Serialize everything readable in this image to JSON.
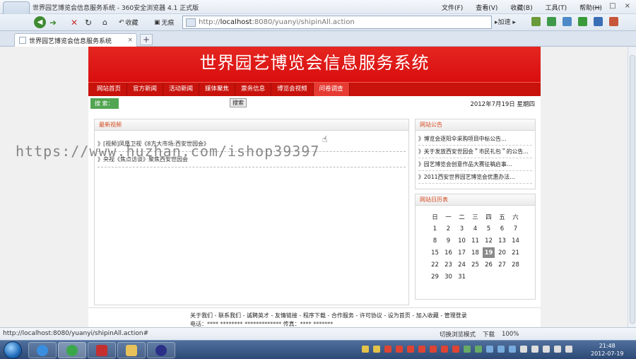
{
  "window": {
    "title": "世界园艺博览会信息服务系统 - 360安全浏览器 4.1 正式版",
    "menus": [
      "文件(F)",
      "查看(V)",
      "收藏(B)",
      "工具(T)",
      "帮助(H)"
    ],
    "controls": [
      "一",
      "□",
      "×"
    ]
  },
  "toolbar": {
    "favorites_label": "收藏",
    "tools_label": "无痕",
    "address_prefix": "http://",
    "address_host": "localhost",
    "address_rest": ":8080/yuanyi/shipinAll.action",
    "go_label": "加速"
  },
  "tab": {
    "title": "世界园艺博览会信息服务系统",
    "close": "×",
    "add": "+"
  },
  "site": {
    "banner_title": "世界园艺博览会信息服务系统",
    "nav": [
      "网站首页",
      "官方新闻",
      "活动新闻",
      "媒体聚焦",
      "票务信息",
      "博览会视频",
      "问卷调查"
    ],
    "search_tag": "搜 索：",
    "search_button": "搜索",
    "date": "2012年7月19日 星期四",
    "news_header": "最新视频",
    "news_items": [
      "》[视频]凤凰卫视《8方大市场:西安世园会》",
      "》央视《焦点访谈》聚焦西安世园会"
    ],
    "notice_header": "网站公告",
    "notices": [
      "》博览会逐阳伞采购项目中标公告…",
      "》关于发放西安世园会＂市民礼包＂的公告…",
      "》园艺博览会创意作品大赛征稿启事…",
      "》2011西安世界园艺博览会优惠办法…"
    ],
    "calendar_header": "网站日历表",
    "calendar_weekdays": [
      "日",
      "一",
      "二",
      "三",
      "四",
      "五",
      "六"
    ],
    "calendar_weeks": [
      [
        "1",
        "2",
        "3",
        "4",
        "5",
        "6",
        "7"
      ],
      [
        "8",
        "9",
        "10",
        "11",
        "12",
        "13",
        "14"
      ],
      [
        "15",
        "16",
        "17",
        "18",
        "19",
        "20",
        "21"
      ],
      [
        "22",
        "23",
        "24",
        "25",
        "26",
        "27",
        "28"
      ],
      [
        "29",
        "30",
        "31",
        "",
        "",
        "",
        ""
      ]
    ],
    "calendar_today": "19",
    "footer_links": "关于我们 - 联系我们 - 诚聘英才 - 友情链接 - 程序下载 - 合作服务 - 许可协议 - 设为首页 - 加入收藏 - 管理登录",
    "footer_line2": "电话：**** ******** ************* 传真：**** *******"
  },
  "watermark": "https://www.huzhan.com/ishop39397",
  "statusbar": {
    "url": "http://localhost:8080/yuanyi/shipinAll.action#",
    "mode": "切换浏览模式",
    "download": "下载",
    "zoom": "100%"
  },
  "taskbar": {
    "time": "21:48",
    "date": "2012-07-19"
  }
}
